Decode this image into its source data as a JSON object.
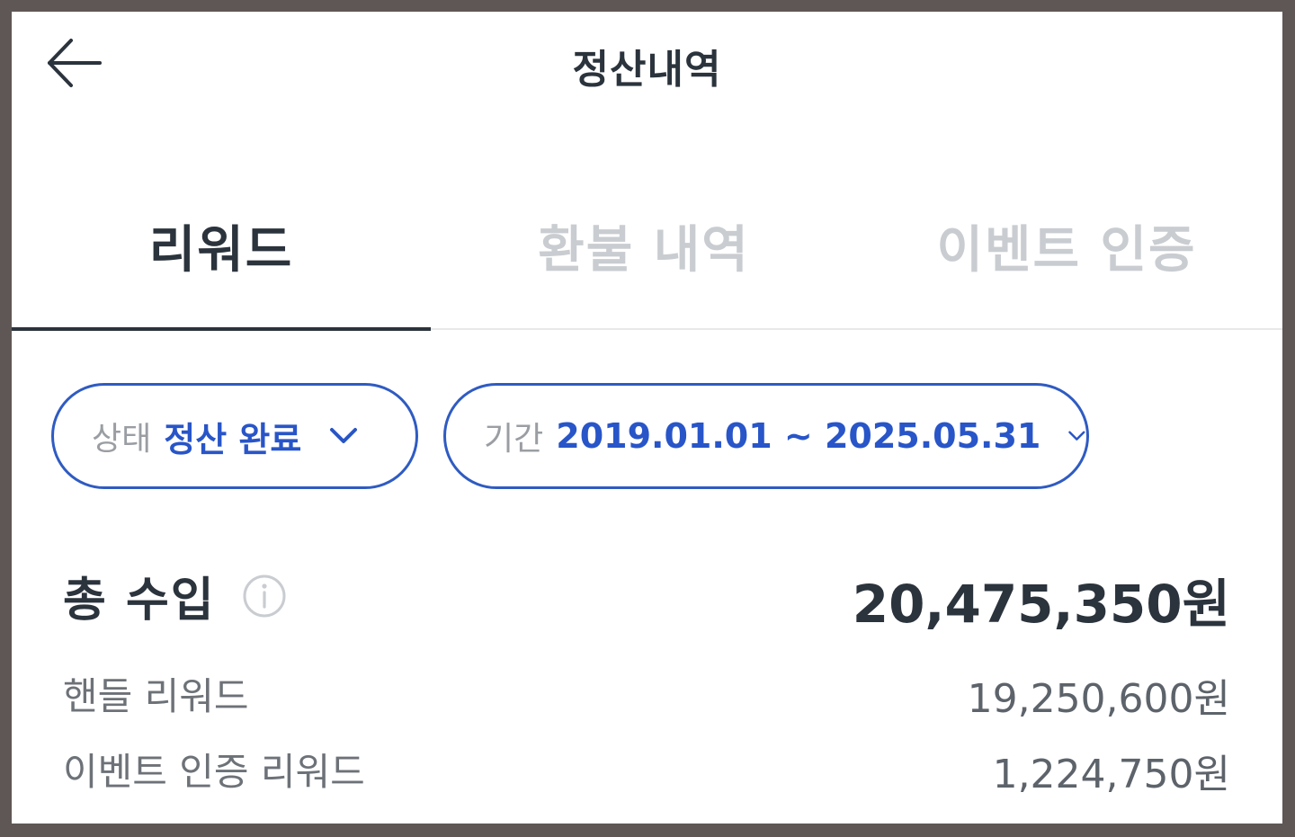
{
  "header": {
    "title": "정산내역",
    "back_icon": "arrow-left-icon"
  },
  "tabs": [
    {
      "label": "리워드",
      "active": true
    },
    {
      "label": "환불 내역",
      "active": false
    },
    {
      "label": "이벤트 인증",
      "active": false
    }
  ],
  "filters": {
    "status": {
      "label": "상태",
      "value": "정산 완료"
    },
    "period": {
      "label": "기간",
      "value": "2019.01.01 ~ 2025.05.31"
    }
  },
  "summary": {
    "total_label": "총 수입",
    "total_amount": "20,475,350원",
    "rows": [
      {
        "label": "핸들 리워드",
        "amount": "19,250,600원"
      },
      {
        "label": "이벤트 인증 리워드",
        "amount": "1,224,750원"
      }
    ]
  },
  "colors": {
    "accent": "#2855c8",
    "text_primary": "#2b333c",
    "text_muted": "#c9ccd0"
  }
}
